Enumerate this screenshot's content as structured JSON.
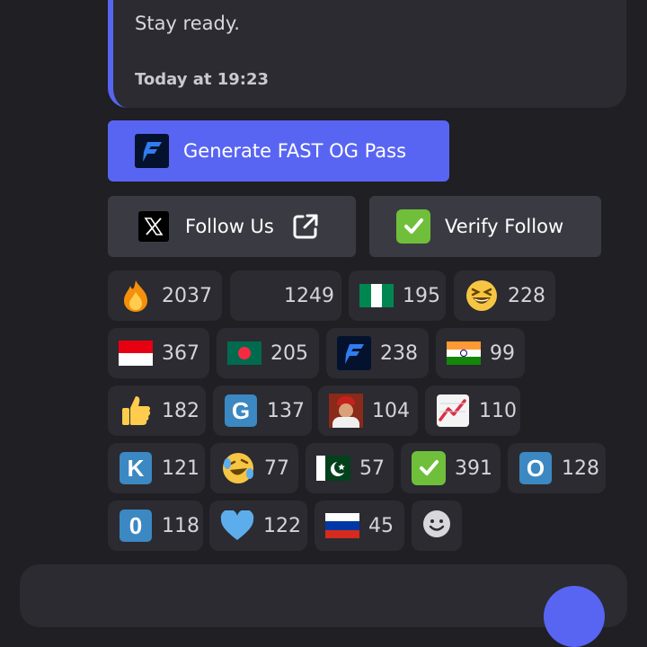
{
  "embed": {
    "description": "Stay ready.",
    "timestamp": "Today at 19:23",
    "accent_color": "#5865f2"
  },
  "buttons": {
    "generate": {
      "label": "Generate FAST OG Pass",
      "icon": "fast-logo-icon",
      "color": "#5865f2"
    },
    "follow": {
      "label": "Follow Us",
      "icon": "x-logo-icon",
      "trailing_icon": "external-link-icon"
    },
    "verify": {
      "label": "Verify Follow",
      "icon": "check-mark-button-icon"
    }
  },
  "reactions": [
    {
      "icon": "fire-icon",
      "count": "2037"
    },
    {
      "icon": "blank",
      "count": "1249"
    },
    {
      "icon": "flag-nigeria-icon",
      "count": "195"
    },
    {
      "icon": "grinning-squinting-face-icon",
      "count": "228"
    },
    {
      "icon": "flag-indonesia-icon",
      "count": "367"
    },
    {
      "icon": "flag-bangladesh-icon",
      "count": "205"
    },
    {
      "icon": "fast-logo-icon",
      "count": "238"
    },
    {
      "icon": "flag-india-icon",
      "count": "99"
    },
    {
      "icon": "thumbs-up-icon",
      "count": "182"
    },
    {
      "icon": "letter-g-icon",
      "count": "137"
    },
    {
      "icon": "avatar-photo-icon",
      "count": "104"
    },
    {
      "icon": "chart-increasing-icon",
      "count": "110"
    },
    {
      "icon": "letter-k-icon",
      "count": "121"
    },
    {
      "icon": "rolling-laughing-face-icon",
      "count": "77"
    },
    {
      "icon": "flag-pakistan-icon",
      "count": "57"
    },
    {
      "icon": "check-mark-button-icon",
      "count": "391"
    },
    {
      "icon": "letter-o-icon",
      "count": "128"
    },
    {
      "icon": "digit-zero-icon",
      "count": "118"
    },
    {
      "icon": "blue-heart-icon",
      "count": "122"
    },
    {
      "icon": "flag-russia-icon",
      "count": "45"
    }
  ],
  "icon_glyphs": {
    "letter_g": "G",
    "letter_k": "K",
    "letter_o": "O",
    "digit_zero": "0"
  },
  "add_reaction": {
    "icon": "add-reaction-smiley-icon"
  }
}
